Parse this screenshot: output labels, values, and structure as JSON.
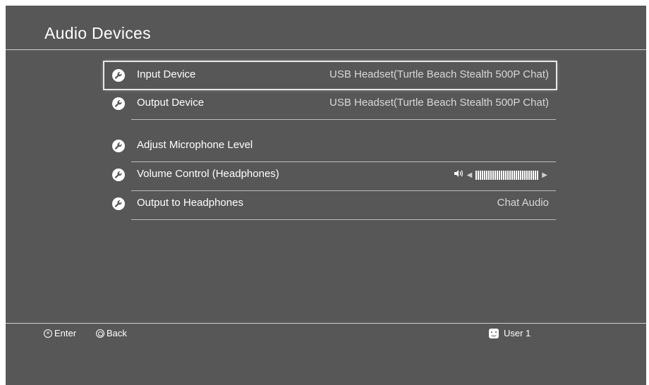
{
  "header": {
    "title": "Audio Devices"
  },
  "rows": [
    {
      "label": "Input Device",
      "value": "USB Headset(Turtle Beach Stealth 500P Chat)",
      "icon": "wrench-icon",
      "selected": true
    },
    {
      "label": "Output Device",
      "value": "USB Headset(Turtle Beach Stealth 500P Chat)",
      "icon": "wrench-icon"
    },
    {
      "label": "Adjust Microphone Level",
      "value": "",
      "icon": "wrench-icon"
    },
    {
      "label": "Volume Control (Headphones)",
      "icon": "wrench-icon",
      "volume": {
        "level": 1.0,
        "icon": "speaker-icon"
      }
    },
    {
      "label": "Output to Headphones",
      "value": "Chat Audio",
      "icon": "wrench-icon"
    }
  ],
  "footer": {
    "enter_label": "Enter",
    "enter_icon": "cross-button-icon",
    "back_label": "Back",
    "back_icon": "circle-button-icon",
    "user_label": "User 1",
    "user_icon": "user-avatar-icon"
  },
  "colors": {
    "background": "#575757",
    "text": "#ffffff",
    "value_text": "#d8d8d8",
    "separator": "#bdbdbd"
  }
}
